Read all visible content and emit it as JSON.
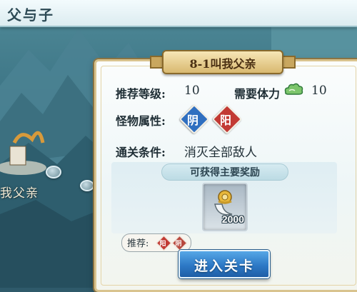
{
  "header": {
    "stage_title": "父与子"
  },
  "map": {
    "node_label": "我父亲"
  },
  "panel": {
    "banner_title": "8-1叫我父亲",
    "recommended_level": {
      "label": "推荐等级:",
      "value": "10"
    },
    "stamina": {
      "label": "需要体力",
      "icon": "cloud-stamina-icon",
      "value": "10"
    },
    "monster_attribute": {
      "label": "怪物属性:",
      "badges": [
        {
          "text": "阴",
          "color": "#2f6fc0"
        },
        {
          "text": "阳",
          "color": "#c23a34"
        }
      ]
    },
    "clear_condition": {
      "label": "通关条件:",
      "value": "消灭全部敌人"
    },
    "rewards": {
      "heading": "可获得主要奖励",
      "items": [
        {
          "icon": "gold-pendant-icon",
          "quantity": "2000"
        }
      ]
    },
    "recommend": {
      "label": "推荐:",
      "badges": [
        {
          "text": "阳",
          "color": "#c23a34"
        },
        {
          "text": "阴",
          "color": "#b8483e"
        }
      ]
    },
    "enter_button": "进入关卡"
  },
  "colors": {
    "panel_gold": "#d9c38e",
    "button_blue": "#2d79c6",
    "yin_blue": "#2f6fc0",
    "yang_red": "#c23a34"
  }
}
